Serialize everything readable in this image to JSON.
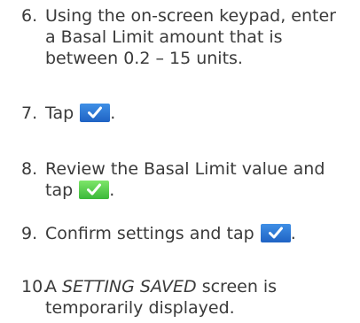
{
  "colors": {
    "text": "#3a3a3a",
    "confirm_blue": "#2a77d8",
    "confirm_green": "#4fc845"
  },
  "icons": {
    "confirm": "checkmark-icon"
  },
  "steps": [
    {
      "number": "6.",
      "line1": "Using the on-screen keypad, enter",
      "line2": "a Basal Limit amount that is",
      "line3": "between 0.2 – 15 units."
    },
    {
      "number": "7.",
      "before": "Tap",
      "after": "."
    },
    {
      "number": "8.",
      "line1": "Review the Basal Limit value and",
      "before": "tap",
      "after": "."
    },
    {
      "number": "9.",
      "before": "Confirm settings and tap",
      "after": "."
    },
    {
      "number": "10.",
      "before": "A",
      "emphasis": "SETTING SAVED",
      "after": "screen is",
      "line2": "temporarily displayed."
    }
  ]
}
